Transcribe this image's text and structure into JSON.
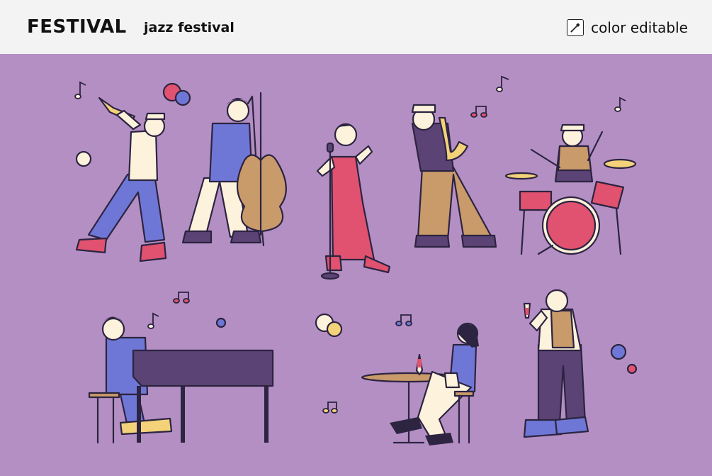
{
  "header": {
    "brand": "FESTIVAL",
    "subtitle": "jazz festival",
    "badge_label": "color editable",
    "badge_icon": "eyedropper-icon"
  },
  "colors": {
    "background": "#b48fc4",
    "header_bg": "#f3f3f3",
    "outline": "#2c2440",
    "red": "#e0526f",
    "blue": "#6f77d6",
    "cream": "#fdf2dc",
    "brown": "#c99a6a",
    "yellow": "#f3d27a",
    "piano": "#5b4375"
  },
  "illustrations": [
    "trumpet-player",
    "double-bass-player",
    "singer",
    "saxophone-player",
    "drummer",
    "pianist",
    "woman-at-table",
    "man-with-wine-glass"
  ]
}
